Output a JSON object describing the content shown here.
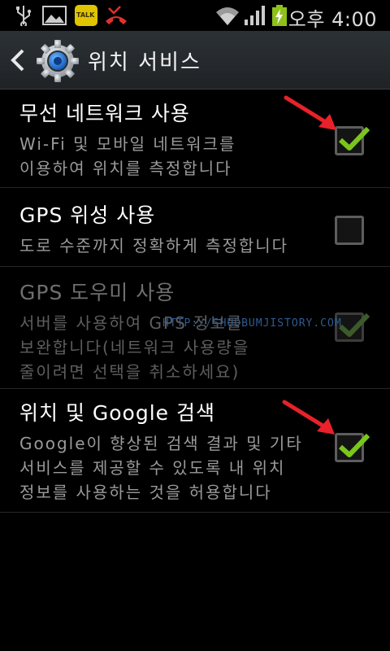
{
  "status_bar": {
    "icons": [
      "usb-icon",
      "image-icon",
      "kakaotalk-icon",
      "missed-call-icon",
      "wifi-icon",
      "signal-icon",
      "battery-charging-icon"
    ],
    "kakaotalk_label": "TALK",
    "ampm": "오후",
    "time": "4:00"
  },
  "action_bar": {
    "title": "위치 서비스"
  },
  "settings": [
    {
      "title": "무선 네트워크 사용",
      "desc": [
        "Wi-Fi 및 모바일 네트워크를",
        "이용하여 위치를 측정합니다"
      ],
      "checked": true,
      "enabled": true
    },
    {
      "title": "GPS 위성 사용",
      "desc": [
        "도로 수준까지 정확하게 측정합니다"
      ],
      "checked": false,
      "enabled": true
    },
    {
      "title": "GPS 도우미 사용",
      "desc": [
        "서버를 사용하여 GPS 정보를",
        "보완합니다(네트워크 사용량을",
        "줄이려면 선택을 취소하세요)"
      ],
      "checked": true,
      "enabled": false
    },
    {
      "title": "위치 및 Google 검색",
      "desc": [
        "Google이 향상된 검색 결과 및 기타",
        "서비스를 제공할 수 있도록 내 위치",
        "정보를 사용하는 것을 허용합니다"
      ],
      "checked": true,
      "enabled": true
    }
  ],
  "watermark": "HTTP://SHUDBUMJISTORY.COM",
  "colors": {
    "check": "#7bc61b",
    "arrow": "#e8212a",
    "action_bar": "#2a2f33"
  }
}
